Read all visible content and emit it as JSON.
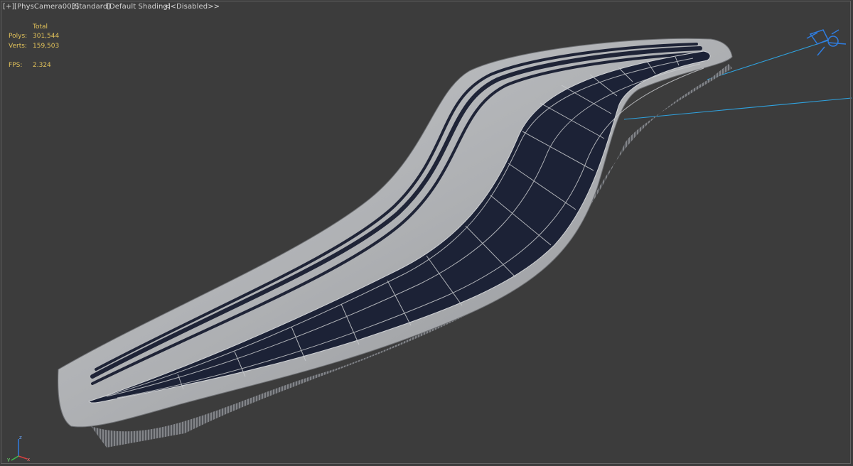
{
  "viewport": {
    "labels": {
      "plus": "[+]",
      "camera": "[PhysCamera003]",
      "shading_mode": "[Standard]",
      "shading": "[Default Shading]",
      "disabled": "<<Disabled>>"
    },
    "stats": {
      "header": "Total",
      "polys_label": "Polys:",
      "polys_value": "301,544",
      "verts_label": "Verts:",
      "verts_value": "159,503",
      "fps_label": "FPS:",
      "fps_value": "2.324"
    }
  },
  "colors": {
    "background": "#3c3c3c",
    "stats_text": "#e3c35a",
    "shell": "#a9abaf",
    "inner_panel": "#1c2236",
    "camera_lines": "#2fa3e0"
  },
  "icons": [
    "camera-icon",
    "axis-gizmo-icon"
  ]
}
